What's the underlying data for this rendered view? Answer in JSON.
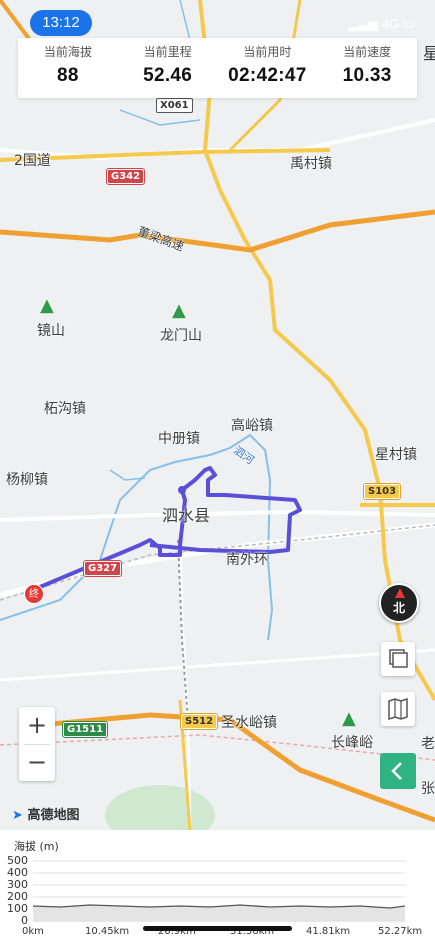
{
  "status": {
    "time": "13:12",
    "network": "4G"
  },
  "stats": [
    {
      "label": "当前海拔",
      "value": "88"
    },
    {
      "label": "当前里程",
      "value": "52.46"
    },
    {
      "label": "当前用时",
      "value": "02:42:47"
    },
    {
      "label": "当前速度",
      "value": "10.33"
    }
  ],
  "edge_char": "星",
  "map": {
    "places": {
      "yucun": "禹村镇",
      "jingshan": "镜山",
      "longmenshan": "龙门山",
      "zhegou": "柘沟镇",
      "zhongce": "中册镇",
      "gaoyu": "高峪镇",
      "xingcun": "星村镇",
      "yangliu": "杨柳镇",
      "sishui": "泗水县",
      "nanwaihuan": "南外环",
      "shengshuiyu": "圣水峪镇",
      "changfengyu": "长峰峪",
      "sihe": "泗河",
      "guodao": "2国道",
      "lao": "老",
      "zhang": "张"
    },
    "roads": {
      "x061": "X061",
      "g342": "G342",
      "s103": "S103",
      "g327": "G327",
      "s512": "S512",
      "g1511": "G1511",
      "expressway": "董梁高速"
    },
    "end_marker": "终",
    "logo": "高德地图",
    "compass": "北",
    "zoom_in": "+",
    "zoom_out": "−",
    "back": "<"
  },
  "elevation": {
    "title": "海拔 (m)",
    "y_ticks": [
      "500",
      "400",
      "300",
      "200",
      "100",
      "0"
    ],
    "x_ticks": [
      "0km",
      "10.45km",
      "20.9km",
      "31.36km",
      "41.81km",
      "52.27km"
    ]
  },
  "colors": {
    "route": "#5a4fd8",
    "highway": "#f0a030",
    "national": "#f6d05a",
    "river": "#7ab8ea",
    "accent": "#1a73e8"
  }
}
